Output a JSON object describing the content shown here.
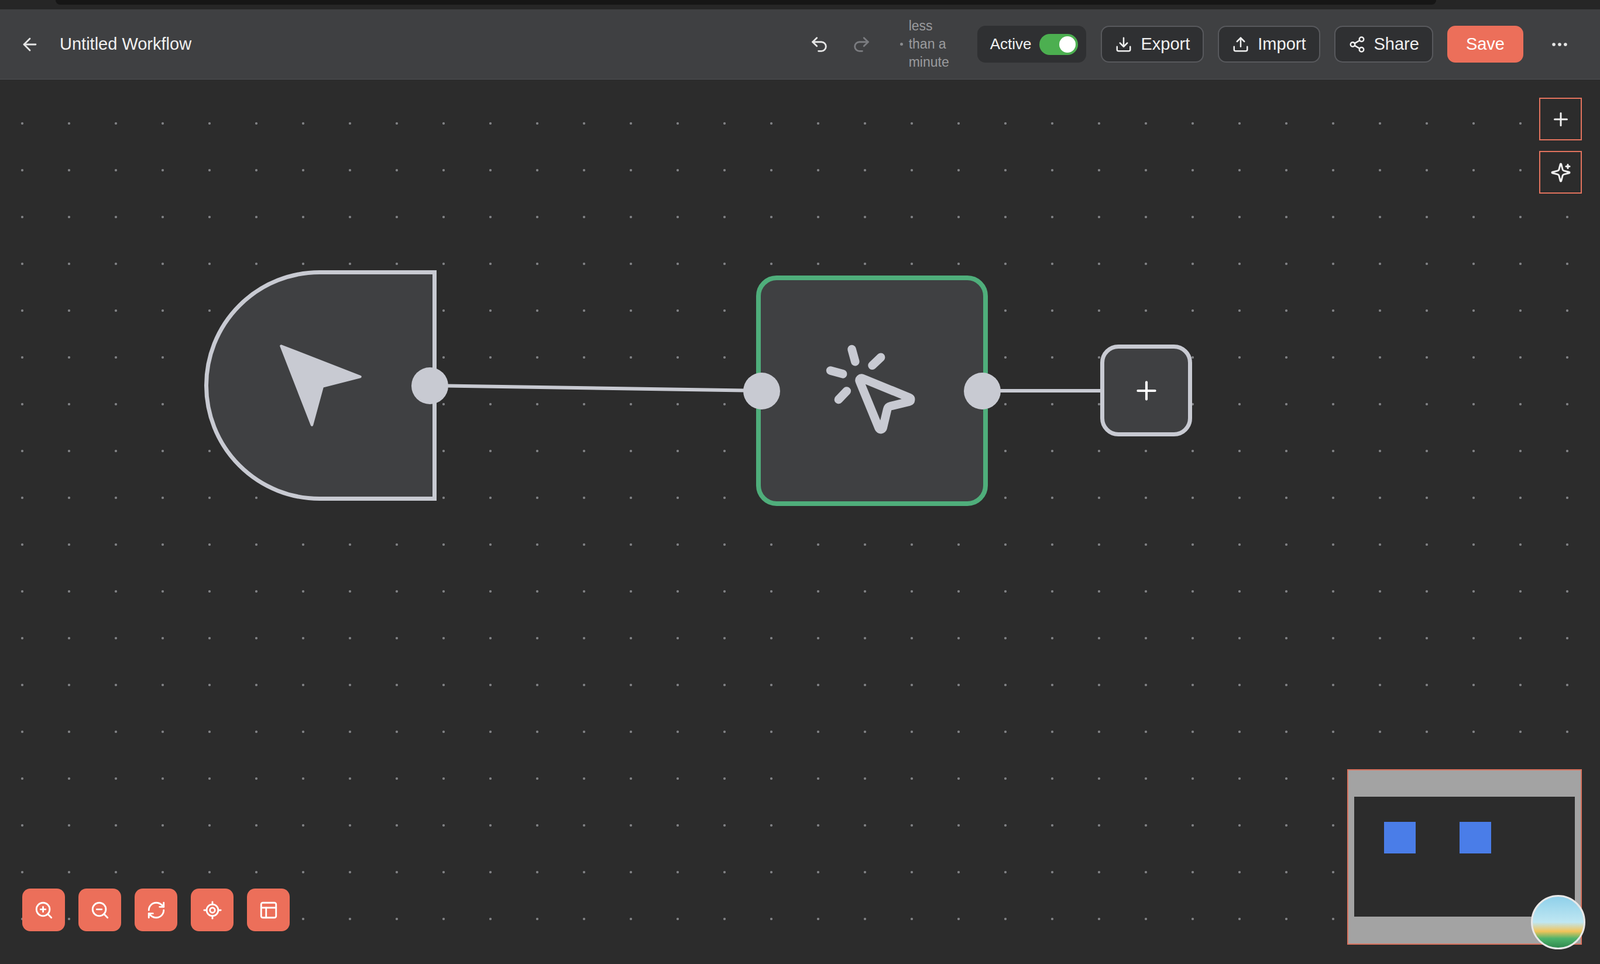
{
  "header": {
    "title": "Untitled Workflow",
    "history": [
      {
        "kind": "undo",
        "disabled": false
      },
      {
        "kind": "redo",
        "disabled": true
      }
    ],
    "saved_time": "less than a minute",
    "active": {
      "label": "Active",
      "on": true
    },
    "buttons": [
      {
        "label": "Export",
        "kind": "export"
      },
      {
        "label": "Import",
        "kind": "import"
      },
      {
        "label": "Share",
        "kind": "share"
      },
      {
        "label": "Save",
        "kind": "save"
      }
    ]
  },
  "nodes": [
    {
      "kind": "trigger",
      "selected": false
    },
    {
      "kind": "action",
      "selected": true
    },
    {
      "kind": "add",
      "selected": false
    }
  ]
}
